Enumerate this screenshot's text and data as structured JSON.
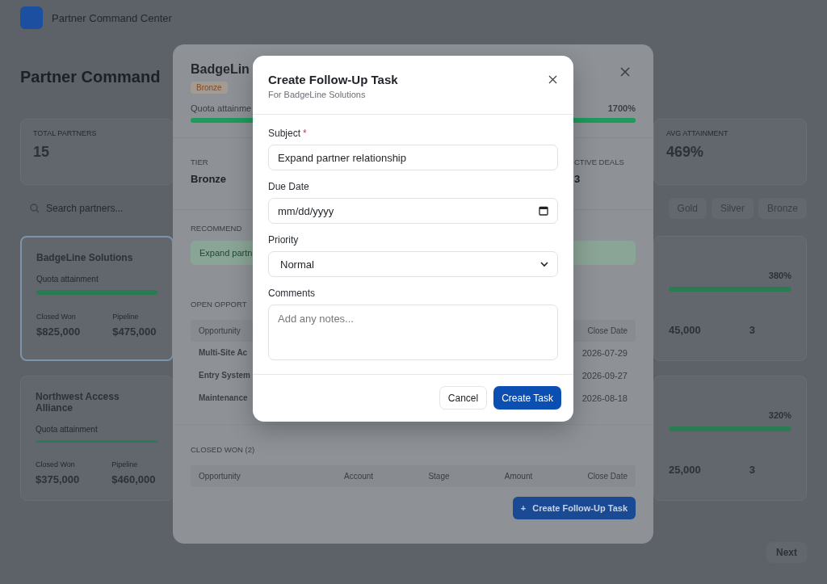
{
  "app_header": {
    "title": "Partner Command Center"
  },
  "page_title": "Partner Command",
  "stats": [
    {
      "label": "TOTAL PARTNERS",
      "value": "15"
    },
    {
      "label": "AVG ATTAINMENT",
      "value": "469%"
    }
  ],
  "search": {
    "placeholder": "Search partners..."
  },
  "filters": [
    {
      "label": "Gold"
    },
    {
      "label": "Silver"
    },
    {
      "label": "Bronze"
    }
  ],
  "partner_cards": [
    {
      "name": "BadgeLine Solutions",
      "quota_label": "Quota attainment",
      "level": 1,
      "selected": true,
      "stats": [
        {
          "label": "Closed Won",
          "value": "$825,000"
        },
        {
          "label": "Pipeline",
          "value": "$475,000"
        }
      ]
    },
    {
      "name": "Northwest Access Alliance",
      "quota_label": "Quota attainment",
      "level": 1,
      "selected": false,
      "stats": [
        {
          "label": "Closed Won",
          "value": "$375,000"
        },
        {
          "label": "Pipeline",
          "value": "$460,000"
        }
      ]
    }
  ],
  "partner_cards_right": [
    {
      "percent": "380%",
      "level": 1,
      "stats": [
        {
          "value": "45,000"
        },
        {
          "value": "3"
        }
      ]
    },
    {
      "percent": "320%",
      "level": 1,
      "stats": [
        {
          "value": "25,000"
        },
        {
          "value": "3"
        }
      ]
    }
  ],
  "pagination": {
    "next": "Next"
  },
  "detail_modal": {
    "title": "BadgeLin",
    "tier_badge": "Bronze",
    "quota_label": "Quota attainme",
    "quota_value": "1700%",
    "level": 1,
    "fields": [
      {
        "label": "TIER",
        "value": "Bronze"
      },
      {
        "label": "CTIVE DEALS",
        "value": "3"
      }
    ],
    "recommended_label": "RECOMMEND",
    "recommendation": "Expand partn",
    "open_label": "OPEN OPPORT",
    "open_columns": [
      "Opportunity",
      "Close Date"
    ],
    "open_rows": [
      [
        "Multi-Site Ac",
        "2026-07-29"
      ],
      [
        "Entry System",
        "2026-09-27"
      ],
      [
        "Maintenance",
        "2026-08-18"
      ]
    ],
    "closed_label": "CLOSED WON (2)",
    "closed_columns": [
      "Opportunity",
      "Account",
      "Stage",
      "Amount",
      "Close Date"
    ],
    "button_icon": "+",
    "button": "Create Follow-Up Task"
  },
  "task_modal": {
    "title": "Create Follow-Up Task",
    "subtitle": "For BadgeLine Solutions",
    "required_mark": "*",
    "fields": [
      {
        "kind": "text",
        "label": "Subject",
        "required": true,
        "value": "Expand partner relationship"
      },
      {
        "kind": "date",
        "label": "Due Date",
        "required": false,
        "placeholder": "mm/dd/yyyy"
      },
      {
        "kind": "select",
        "label": "Priority",
        "required": false,
        "value": "Normal"
      },
      {
        "kind": "textarea",
        "label": "Comments",
        "required": false,
        "placeholder": "Add any notes..."
      }
    ],
    "buttons": [
      {
        "kind": "secondary",
        "label": "Cancel"
      },
      {
        "kind": "primary",
        "label": "Create Task"
      }
    ]
  }
}
